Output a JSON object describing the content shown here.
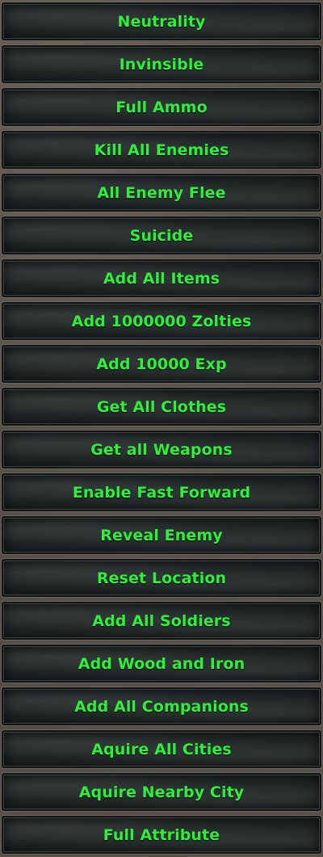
{
  "menu": {
    "label_color": "#2ef03a",
    "items": [
      {
        "label": "Neutrality"
      },
      {
        "label": "Invinsible"
      },
      {
        "label": "Full Ammo"
      },
      {
        "label": "Kill All Enemies"
      },
      {
        "label": "All Enemy Flee"
      },
      {
        "label": "Suicide"
      },
      {
        "label": "Add All Items"
      },
      {
        "label": "Add 1000000 Zolties"
      },
      {
        "label": "Add 10000 Exp"
      },
      {
        "label": "Get All Clothes"
      },
      {
        "label": "Get all Weapons"
      },
      {
        "label": "Enable Fast Forward"
      },
      {
        "label": "Reveal Enemy"
      },
      {
        "label": "Reset Location"
      },
      {
        "label": "Add All Soldiers"
      },
      {
        "label": "Add Wood and Iron"
      },
      {
        "label": "Add All Companions"
      },
      {
        "label": "Aquire All Cities"
      },
      {
        "label": "Aquire Nearby City"
      },
      {
        "label": "Full Attribute"
      }
    ]
  }
}
